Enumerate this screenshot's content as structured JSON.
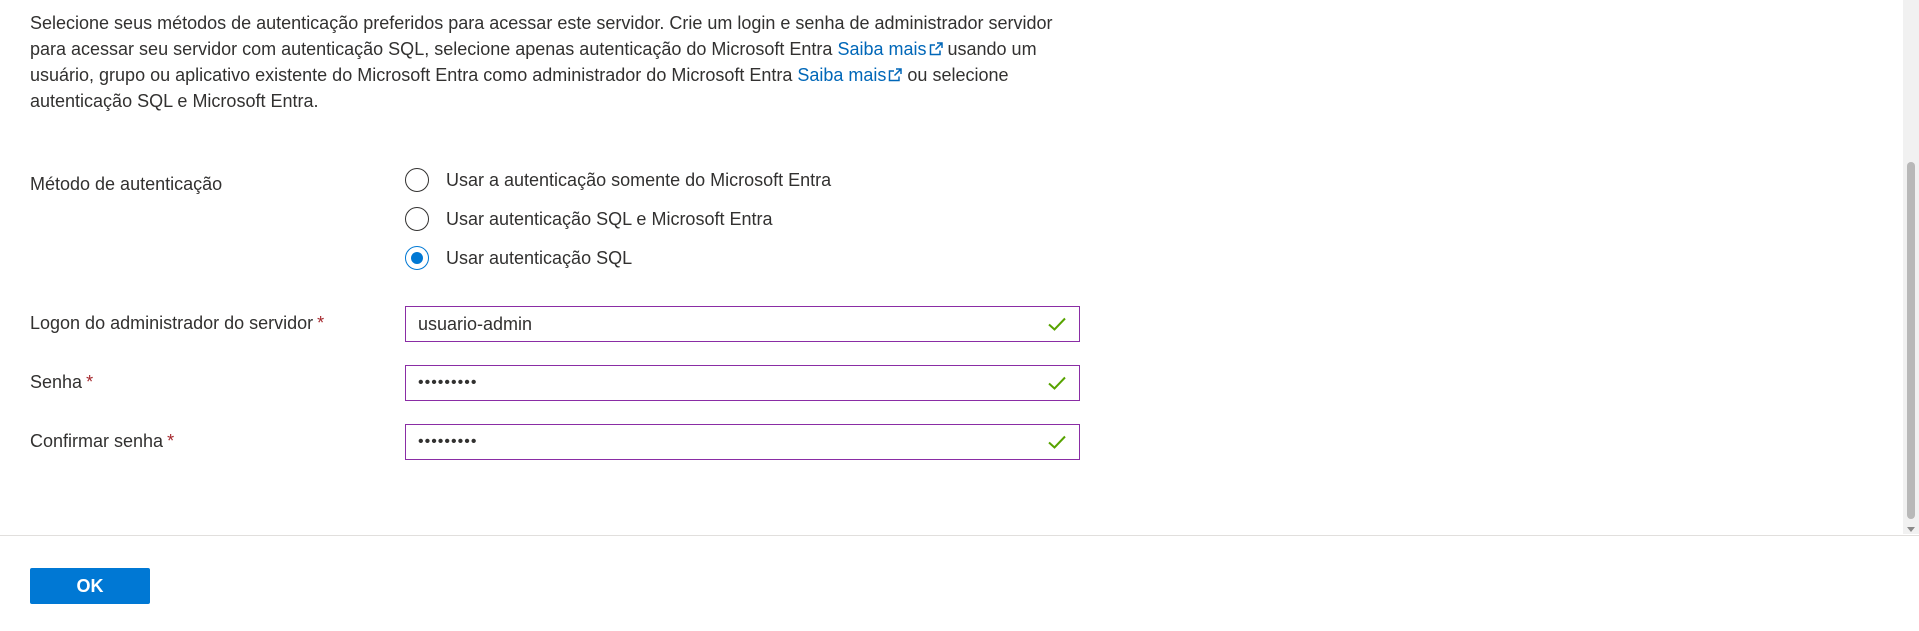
{
  "intro": {
    "part1": "Selecione seus métodos de autenticação preferidos para acessar este servidor. Crie um login e senha de administrador servidor para acessar seu servidor com autenticação SQL, selecione apenas autenticação do Microsoft Entra ",
    "link1": "Saiba mais",
    "part2": " usando um usuário, grupo ou aplicativo existente do Microsoft Entra como administrador do Microsoft Entra ",
    "link2": "Saiba mais",
    "part3": " ou selecione autenticação SQL e Microsoft Entra."
  },
  "auth_method": {
    "label": "Método de autenticação",
    "options": [
      {
        "label": "Usar a autenticação somente do Microsoft Entra",
        "selected": false
      },
      {
        "label": "Usar autenticação SQL e Microsoft Entra",
        "selected": false
      },
      {
        "label": "Usar autenticação SQL",
        "selected": true
      }
    ]
  },
  "fields": {
    "admin_login": {
      "label": "Logon do administrador do servidor",
      "required_mark": "*",
      "value": "usuario-admin",
      "valid": true
    },
    "password": {
      "label": "Senha",
      "required_mark": "*",
      "value": "•••••••••",
      "valid": true
    },
    "confirm_password": {
      "label": "Confirmar senha",
      "required_mark": "*",
      "value": "•••••••••",
      "valid": true
    }
  },
  "footer": {
    "ok_label": "OK"
  },
  "colors": {
    "accent": "#0078d4",
    "link": "#0067b8",
    "field_border": "#8a2da5",
    "valid_check": "#57a300",
    "required": "#a4262c"
  },
  "icons": {
    "external_link": "external-link-icon",
    "valid": "checkmark-icon"
  }
}
